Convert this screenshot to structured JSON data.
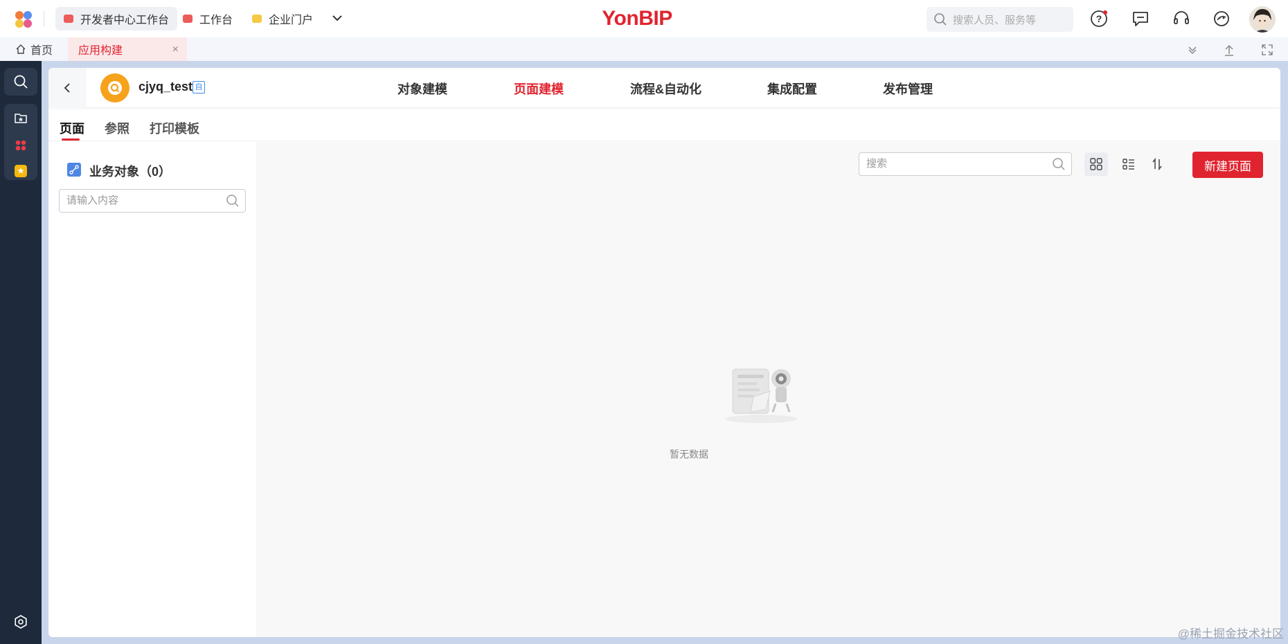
{
  "topbar": {
    "tabs": [
      {
        "label": "开发者中心工作台",
        "icon": "workbench-icon"
      },
      {
        "label": "工作台",
        "icon": "workbench-icon"
      },
      {
        "label": "企业门户",
        "icon": "portal-icon"
      }
    ],
    "brand": "YonBIP",
    "search_placeholder": "搜索人员、服务等"
  },
  "tabstrip": {
    "home_label": "首页",
    "active_tab_label": "应用构建",
    "close_symbol": "×"
  },
  "app": {
    "name": "cjyq_test",
    "badge": "自"
  },
  "nav": [
    "对象建模",
    "页面建模",
    "流程&自动化",
    "集成配置",
    "发布管理"
  ],
  "subtabs": [
    "页面",
    "参照",
    "打印模板"
  ],
  "sidepanel": {
    "title": "业务对象（0）",
    "search_placeholder": "请输入内容"
  },
  "content": {
    "search_placeholder": "搜索",
    "new_button": "新建页面",
    "empty_text": "暂无数据"
  },
  "watermark": "@稀土掘金技术社区",
  "colors": {
    "accent": "#e0242f",
    "rail": "#1e2a3c"
  }
}
